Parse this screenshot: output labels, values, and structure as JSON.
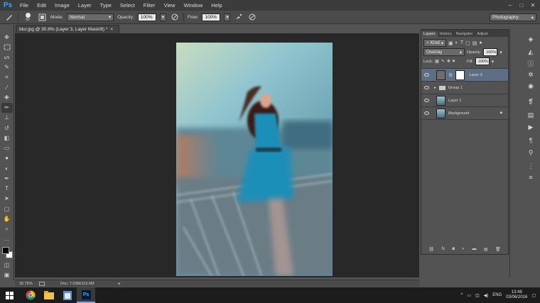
{
  "app": {
    "logo": "Ps",
    "menu": [
      "File",
      "Edit",
      "Image",
      "Layer",
      "Type",
      "Select",
      "Filter",
      "View",
      "Window",
      "Help"
    ],
    "window_controls": [
      "–",
      "□",
      "✕"
    ]
  },
  "options": {
    "brush_size": "50",
    "mode_label": "Mode:",
    "mode_value": "Normal",
    "opacity_label": "Opacity:",
    "opacity_value": "100%",
    "flow_label": "Flow:",
    "flow_value": "100%",
    "workspace": "Photography"
  },
  "document": {
    "tab_title": "blur.jpg @ 30.8% (Layer 3, Layer Mask/8) *",
    "close": "×"
  },
  "status": {
    "zoom": "30.76%",
    "doc_info": "Doc: 7.03M/115.6M"
  },
  "panel": {
    "tabs": [
      "Layers",
      "History",
      "Navigator",
      "Adjust"
    ],
    "kind_label": "Kind",
    "blend_mode": "Overlay",
    "opacity_label": "Opacity:",
    "opacity_value": "100%",
    "lock_label": "Lock:",
    "fill_label": "Fill:",
    "fill_value": "100%",
    "layers": [
      {
        "name": "Layer 3"
      },
      {
        "name": "Group 1"
      },
      {
        "name": "Layer 1"
      },
      {
        "name": "Background"
      }
    ]
  },
  "taskbar": {
    "ps_label": "Ps",
    "lang": "ENG",
    "time": "13:48",
    "date": "03/06/2016"
  },
  "colors": {
    "accent": "#31a8ff",
    "selected_layer": "#5e6e85",
    "canvas_bg": "#282828"
  }
}
